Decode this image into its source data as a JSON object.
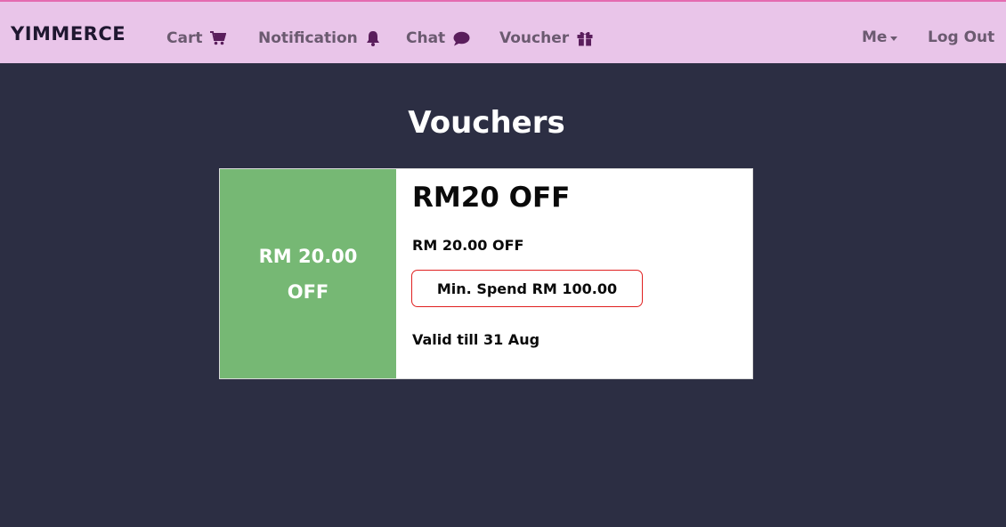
{
  "navbar": {
    "brand": "YIMMERCE",
    "items": [
      {
        "label": "Cart",
        "icon": "cart-icon"
      },
      {
        "label": "Notification",
        "icon": "bell-icon"
      },
      {
        "label": "Chat",
        "icon": "chat-icon"
      },
      {
        "label": "Voucher",
        "icon": "gift-icon"
      }
    ],
    "me_label": "Me",
    "logout_label": "Log Out",
    "colors": {
      "background": "#e9c5e9",
      "icon": "#5a1e5c"
    }
  },
  "page": {
    "title": "Vouchers",
    "background": "#2c2e43"
  },
  "voucher": {
    "badge_line1": "RM 20.00",
    "badge_line2": "OFF",
    "heading": "RM20 OFF",
    "subtitle": "RM 20.00 OFF",
    "min_spend": "Min. Spend RM 100.00",
    "valid": "Valid till 31 Aug",
    "colors": {
      "badge": "#76b874",
      "min_spend_border": "#e02020"
    }
  }
}
